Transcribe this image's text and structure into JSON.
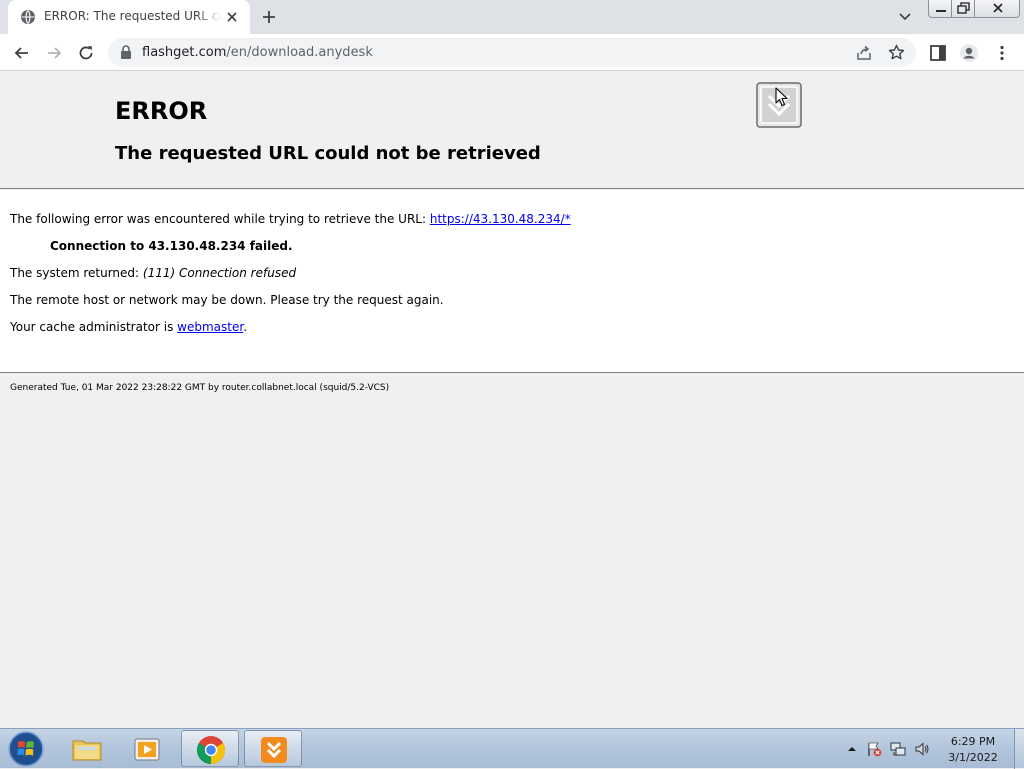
{
  "browser": {
    "tab": {
      "title": "ERROR: The requested URL could not be retrieved"
    },
    "url": {
      "host": "flashget.com",
      "path": "/en/download.anydesk"
    }
  },
  "page": {
    "heading": "ERROR",
    "subheading": "The requested URL could not be retrieved",
    "intro": "The following error was encountered while trying to retrieve the URL: ",
    "intro_link": "https://43.130.48.234/*",
    "connection_failed": "Connection to 43.130.48.234 failed.",
    "system_returned_label": "The system returned: ",
    "system_returned_value": "(111) Connection refused",
    "remote_down": "The remote host or network may be down. Please try the request again.",
    "cache_admin_prefix": "Your cache administrator is ",
    "cache_admin_link": "webmaster",
    "cache_admin_suffix": ".",
    "footer": "Generated Tue, 01 Mar 2022 23:28:22 GMT by router.collabnet.local (squid/5.2-VCS)"
  },
  "taskbar": {
    "apps": [
      {
        "name": "file-explorer",
        "active": false
      },
      {
        "name": "media-player",
        "active": false
      },
      {
        "name": "chrome",
        "active": true
      },
      {
        "name": "flashget",
        "active": true
      }
    ],
    "clock": {
      "time": "6:29 PM",
      "date": "3/1/2022"
    }
  },
  "colors": {
    "link": "#0000ee",
    "taskbar": "#b3c6dc",
    "page_bg": "#f0f0f0"
  }
}
